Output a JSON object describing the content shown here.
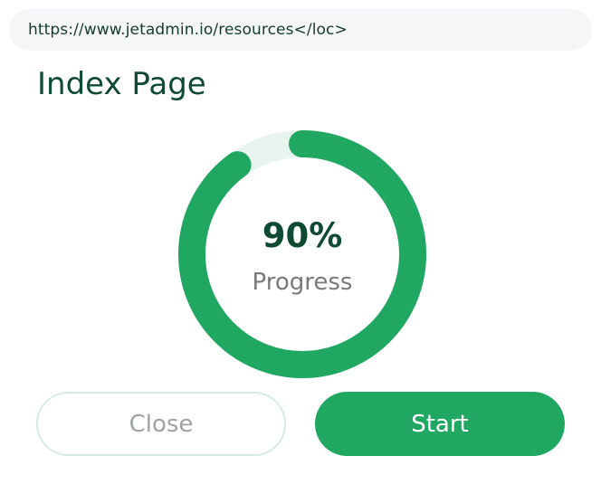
{
  "url_bar": {
    "url": "https://www.jetadmin.io/resources</loc>"
  },
  "page": {
    "title": "Index Page"
  },
  "progress": {
    "value": 90,
    "percent_label": "90%",
    "label": "Progress"
  },
  "buttons": {
    "close_label": "Close",
    "start_label": "Start"
  },
  "colors": {
    "accent": "#20a862",
    "track": "#e8f5ef",
    "title": "#0f4a33",
    "url_bar_bg": "#f5f6f7"
  }
}
